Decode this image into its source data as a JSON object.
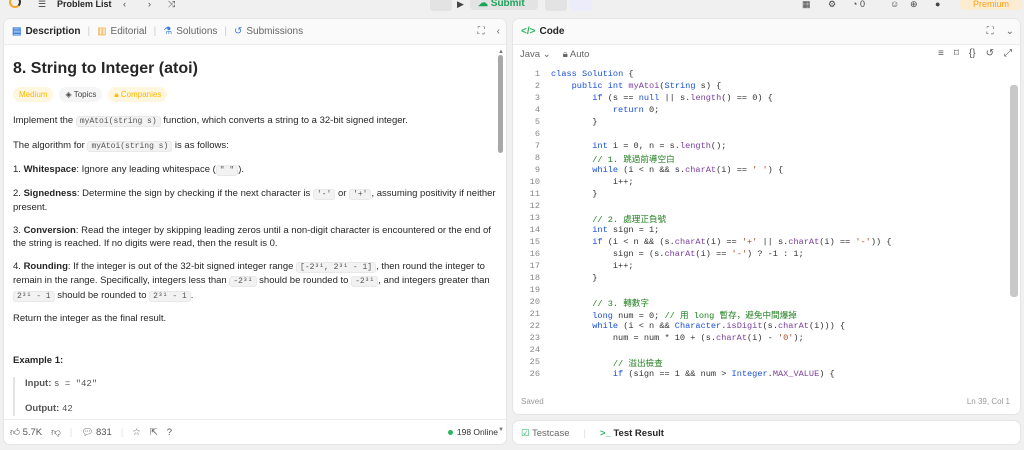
{
  "header": {
    "problem_list": "Problem List",
    "submit": "Submit",
    "premium": "Premium",
    "streak": "0"
  },
  "left": {
    "tabs": [
      "Description",
      "Editorial",
      "Solutions",
      "Submissions"
    ],
    "title": "8. String to Integer (atoi)",
    "tags": [
      "Medium",
      "Topics",
      "Companies"
    ],
    "p1a": "Implement the ",
    "p1code": "myAtoi(string s)",
    "p1b": " function, which converts a string to a 32-bit signed integer.",
    "p2a": "The algorithm for ",
    "p2code": "myAtoi(string s)",
    "p2b": " is as follows:",
    "items": [
      {
        "n": "1. ",
        "k": "Whitespace",
        "t": ": Ignore any leading whitespace (",
        "c": "\" \"",
        "t2": ")."
      },
      {
        "n": "2. ",
        "k": "Signedness",
        "t": ": Determine the sign by checking if the next character is ",
        "c": "'-'",
        "t2": " or ",
        "c2": "'+'",
        "t3": ", assuming positivity if neither present."
      },
      {
        "n": "3. ",
        "k": "Conversion",
        "t": ": Read the integer by skipping leading zeros until a non-digit character is encountered or the end of the string is reached. If no digits were read, then the result is 0."
      },
      {
        "n": "4. ",
        "k": "Rounding",
        "t": ": If the integer is out of the 32-bit signed integer range ",
        "c": "[-2³¹, 2³¹ - 1]",
        "t2": ", then round the integer to remain in the range. Specifically, integers less than ",
        "c2": "-2³¹",
        "t3": " should be rounded to ",
        "c3": "-2³¹",
        "t4": ", and integers greater than ",
        "c4": "2³¹ - 1",
        "t5": " should be rounded to ",
        "c5": "2³¹ - 1",
        "t6": "."
      }
    ],
    "p3": "Return the integer as the final result.",
    "example_title": "Example 1:",
    "input_label": "Input:",
    "input_val": "s = \"42\"",
    "output_label": "Output:",
    "output_val": "42",
    "likes": "5.7K",
    "comments": "831",
    "online": "198 Online"
  },
  "right": {
    "tab": "Code",
    "lang": "Java",
    "auto": "Auto",
    "saved": "Saved",
    "pos": "Ln 39, Col 1",
    "bottom_tabs": [
      "Testcase",
      "Test Result"
    ]
  }
}
